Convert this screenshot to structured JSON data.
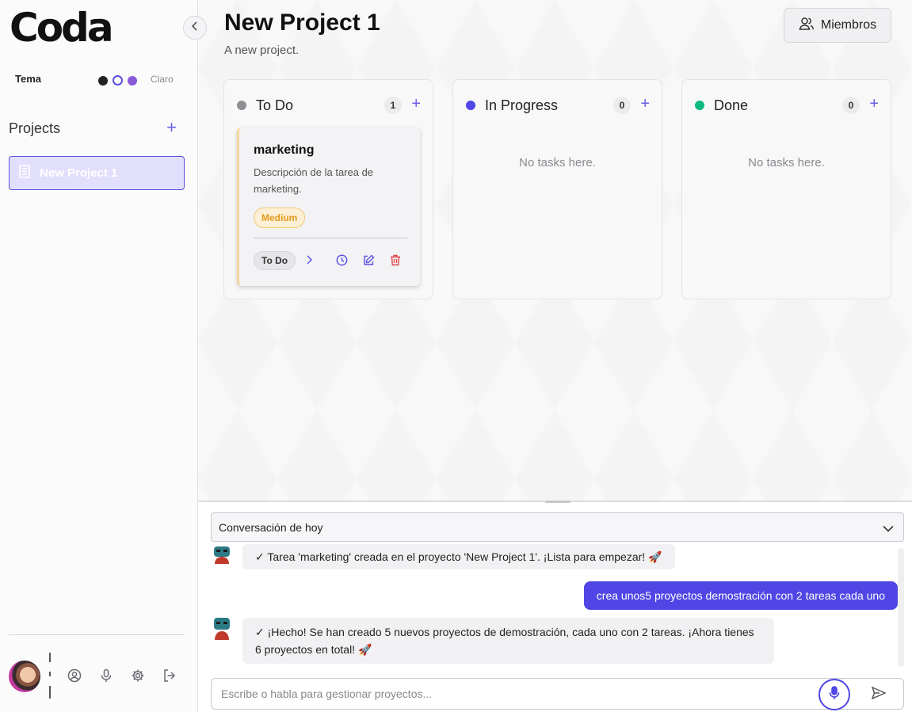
{
  "app": {
    "logo": "Coda"
  },
  "theme": {
    "label": "Tema",
    "value": "Claro"
  },
  "sidebar": {
    "projects_title": "Projects",
    "add_symbol": "+",
    "projects": [
      {
        "label": "New Project 1",
        "icon": "document-icon"
      }
    ]
  },
  "header": {
    "title": "New Project 1",
    "subtitle": "A new project.",
    "members_label": "Miembros"
  },
  "columns": [
    {
      "title": "To Do",
      "count": "1",
      "color": "#8e8e93",
      "add": "+"
    },
    {
      "title": "In Progress",
      "count": "0",
      "color": "#4f46e5",
      "add": "+",
      "empty": "No tasks here."
    },
    {
      "title": "Done",
      "count": "0",
      "color": "#10b981",
      "add": "+",
      "empty": "No tasks here."
    }
  ],
  "task": {
    "title": "marketing",
    "description": "Descripción de la tarea de marketing.",
    "priority": "Medium",
    "status": "To Do",
    "accent": "#f3d79c"
  },
  "chat": {
    "conversation": "Conversación de hoy",
    "messages": [
      {
        "role": "bot",
        "text": "✓ Tarea 'marketing' creada en el proyecto 'New Project 1'. ¡Lista para empezar! 🚀"
      },
      {
        "role": "user",
        "text": "crea unos5 proyectos demostración con 2 tareas cada uno"
      },
      {
        "role": "bot",
        "text": "✓ ¡Hecho! Se han creado 5 nuevos proyectos de demostración, cada uno con 2 tareas. ¡Ahora tienes 6 proyectos en total! 🚀"
      }
    ],
    "input_placeholder": "Escribe o habla para gestionar proyectos...",
    "input_value": ""
  },
  "colors": {
    "accent": "#4f46e5",
    "danger": "#e0474c"
  }
}
